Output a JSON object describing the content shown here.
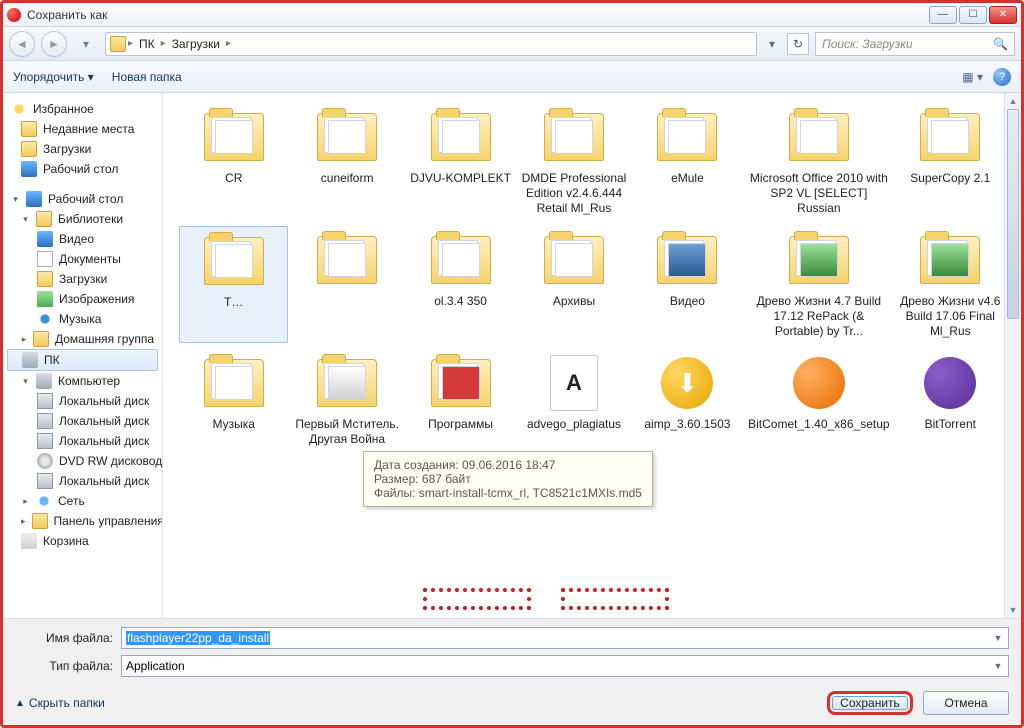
{
  "window": {
    "title": "Сохранить как"
  },
  "breadcrumb": {
    "seg1": "ПК",
    "seg2": "Загрузки"
  },
  "search": {
    "placeholder": "Поиск: Загрузки"
  },
  "toolbar": {
    "organize": "Упорядочить",
    "newfolder": "Новая папка"
  },
  "sidebar": {
    "fav": "Избранное",
    "recent": "Недавние места",
    "downloads": "Загрузки",
    "desktop": "Рабочий стол",
    "desktop2": "Рабочий стол",
    "libs": "Библиотеки",
    "video": "Видео",
    "docs": "Документы",
    "dls": "Загрузки",
    "images": "Изображения",
    "music": "Музыка",
    "homegroup": "Домашняя группа",
    "pc": "ПК",
    "computer": "Компьютер",
    "local1": "Локальный диск",
    "local2": "Локальный диск",
    "local3": "Локальный диск",
    "dvd": "DVD RW дисковод",
    "local4": "Локальный диск",
    "network": "Сеть",
    "panel": "Панель управления",
    "bin": "Корзина"
  },
  "tooltip": {
    "l1": "Дата создания: 09.06.2016 18:47",
    "l2": "Размер: 687 байт",
    "l3": "Файлы: smart-install-tcmx_rl, TC8521c1MXIs.md5"
  },
  "items": {
    "r1": [
      "CR",
      "cuneiform",
      "DJVU-KOMPLEKT",
      "DMDE Professional Edition v2.4.6.444 Retail Ml_Rus",
      "eMule",
      "Microsoft Office 2010 with SP2 VL [SELECT] Russian",
      "SuperCopy 2.1"
    ],
    "r2": [
      "T…",
      "",
      "ol.3.4 350",
      "Архивы",
      "Видео",
      "Древо Жизни 4.7 Build 17.12 RePack (& Portable) by Tr...",
      "Древо Жизни v4.6 Build 17.06 Final Ml_Rus"
    ],
    "r3": [
      "Музыка",
      "Первый Мститель. Другая Война",
      "Программы",
      "advego_plagiatus",
      "aimp_3.60.1503",
      "BitComet_1.40_x86_setup",
      "BitTorrent"
    ]
  },
  "footer": {
    "name_label": "Имя файла:",
    "name_value": "flashplayer22pp_da_install",
    "type_label": "Тип файла:",
    "type_value": "Application",
    "hide": "Скрыть папки",
    "save": "Сохранить",
    "cancel": "Отмена"
  }
}
